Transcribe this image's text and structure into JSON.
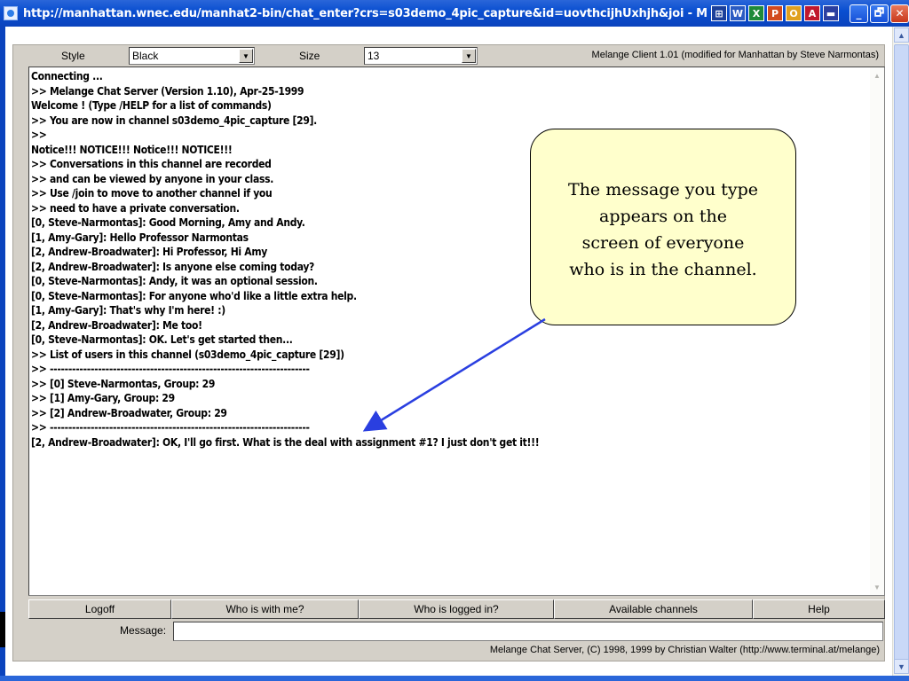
{
  "window": {
    "title": "http://manhattan.wnec.edu/manhat2-bin/chat_enter?crs=s03demo_4pic_capture&id=uovthcijhUxhjh&joi - Microsoft Inter",
    "tray_icons": [
      "windows-flag-icon",
      "word-icon",
      "excel-icon",
      "powerpoint-icon",
      "outlook-icon",
      "acrobat-icon",
      "desktop-icon"
    ],
    "buttons": {
      "minimize": "_",
      "maximize": "🗗",
      "close": "✕"
    }
  },
  "toolbar": {
    "style_label": "Style",
    "style_value": "Black",
    "size_label": "Size",
    "size_value": "13",
    "client_version": "Melange Client 1.01 (modified for Manhattan by Steve Narmontas)"
  },
  "chat": {
    "lines": [
      "Connecting ...",
      ">> Melange Chat Server (Version 1.10), Apr-25-1999",
      "Welcome ! (Type /HELP for a list of commands)",
      ">> You are now in channel s03demo_4pic_capture [29].",
      ">>",
      "Notice!!! NOTICE!!! Notice!!! NOTICE!!!",
      ">> Conversations in this channel are recorded",
      ">> and can be viewed by anyone in your class.",
      ">> Use /join to move to another channel if you",
      ">> need to have a private conversation.",
      "[0, Steve-Narmontas]: Good Morning, Amy and Andy.",
      "[1, Amy-Gary]: Hello Professor Narmontas",
      "[2, Andrew-Broadwater]: Hi Professor, Hi Amy",
      "[2, Andrew-Broadwater]: Is anyone else coming today?",
      "[0, Steve-Narmontas]: Andy, it was an optional session.",
      "[0, Steve-Narmontas]: For anyone who'd like a little extra help.",
      "[1, Amy-Gary]: That's why I'm here! :)",
      "[2, Andrew-Broadwater]: Me too!",
      "[0, Steve-Narmontas]: OK. Let's get started then...",
      ">> List of users in this channel (s03demo_4pic_capture [29])",
      ">> ----------------------------------------------------------------------",
      ">> [0] Steve-Narmontas, Group: 29",
      ">> [1] Amy-Gary, Group: 29",
      ">> [2] Andrew-Broadwater, Group: 29",
      ">> ----------------------------------------------------------------------",
      "[2, Andrew-Broadwater]: OK, I'll go first. What is the deal with assignment #1? I just don't get it!!!"
    ]
  },
  "callout": {
    "lines": [
      "The message you type",
      "appears on the",
      "screen of everyone",
      "who is in the channel."
    ]
  },
  "buttons": {
    "logoff": "Logoff",
    "who_with_me": "Who is with me?",
    "who_logged_in": "Who is logged in?",
    "available_channels": "Available channels",
    "help": "Help"
  },
  "message": {
    "label": "Message:",
    "value": ""
  },
  "footer": "Melange Chat Server, (C) 1998, 1999 by Christian Walter  (http://www.terminal.at/melange)"
}
